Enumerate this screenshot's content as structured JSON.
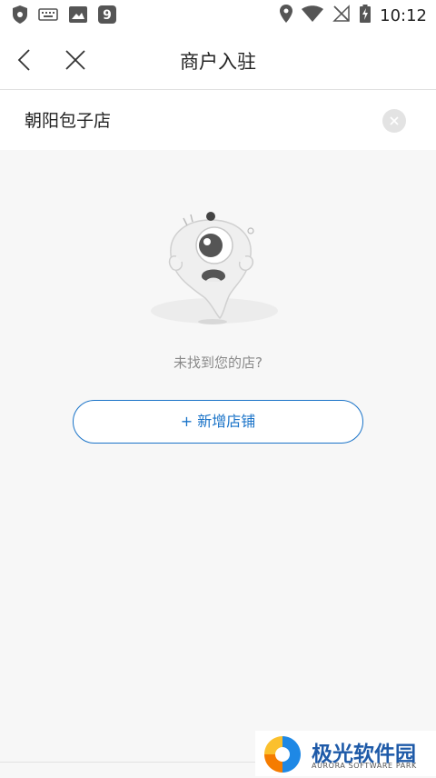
{
  "status_bar": {
    "time": "10:12",
    "icons": [
      "shield-icon",
      "keyboard-icon",
      "image-icon",
      "app-9-icon",
      "location-icon",
      "wifi-icon",
      "no-sim-icon",
      "battery-charging-icon"
    ]
  },
  "header": {
    "title": "商户入驻",
    "back_icon": "chevron-left-icon",
    "close_icon": "close-icon"
  },
  "search": {
    "value": "朝阳包子店",
    "clear_icon": "clear-circle-icon"
  },
  "empty_state": {
    "illustration": "crying-mascot-illustration",
    "message": "未找到您的店?",
    "add_button_label": "+ 新增店铺"
  },
  "watermark": {
    "name": "极光软件园",
    "subtitle": "AURORA SOFTWARE PARK"
  },
  "colors": {
    "accent": "#1a73c8",
    "background": "#f7f7f7",
    "muted_text": "#8a8a8a"
  }
}
